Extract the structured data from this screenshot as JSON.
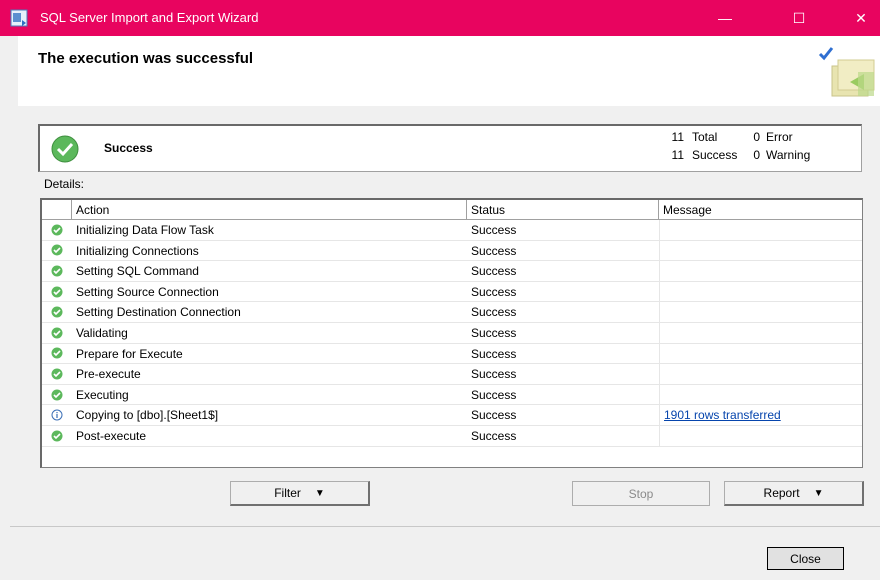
{
  "window": {
    "title": "SQL Server Import and Export Wizard",
    "controls": {
      "minimize": "—",
      "maximize": "☐",
      "close": "✕"
    },
    "accent_color": "#e8045f"
  },
  "header": {
    "title": "The execution was successful"
  },
  "summary": {
    "status": "Success",
    "total_count": "11",
    "total_label": "Total",
    "error_count": "0",
    "error_label": "Error",
    "success_count": "11",
    "success_label": "Success",
    "warning_count": "0",
    "warning_label": "Warning"
  },
  "details": {
    "label": "Details:",
    "columns": [
      "Action",
      "Status",
      "Message"
    ],
    "rows": [
      {
        "icon": "success-check-icon",
        "action": "Initializing Data Flow Task",
        "status": "Success",
        "message": ""
      },
      {
        "icon": "success-check-icon",
        "action": "Initializing Connections",
        "status": "Success",
        "message": ""
      },
      {
        "icon": "success-check-icon",
        "action": "Setting SQL Command",
        "status": "Success",
        "message": ""
      },
      {
        "icon": "success-check-icon",
        "action": "Setting Source Connection",
        "status": "Success",
        "message": ""
      },
      {
        "icon": "success-check-icon",
        "action": "Setting Destination Connection",
        "status": "Success",
        "message": ""
      },
      {
        "icon": "success-check-icon",
        "action": "Validating",
        "status": "Success",
        "message": ""
      },
      {
        "icon": "success-check-icon",
        "action": "Prepare for Execute",
        "status": "Success",
        "message": ""
      },
      {
        "icon": "success-check-icon",
        "action": "Pre-execute",
        "status": "Success",
        "message": ""
      },
      {
        "icon": "success-check-icon",
        "action": "Executing",
        "status": "Success",
        "message": ""
      },
      {
        "icon": "info-icon",
        "action": "Copying to [dbo].[Sheet1$]",
        "status": "Success",
        "message": "1901 rows transferred"
      },
      {
        "icon": "success-check-icon",
        "action": "Post-execute",
        "status": "Success",
        "message": ""
      }
    ]
  },
  "buttons": {
    "filter": "Filter",
    "stop": "Stop",
    "report": "Report",
    "close": "Close"
  }
}
